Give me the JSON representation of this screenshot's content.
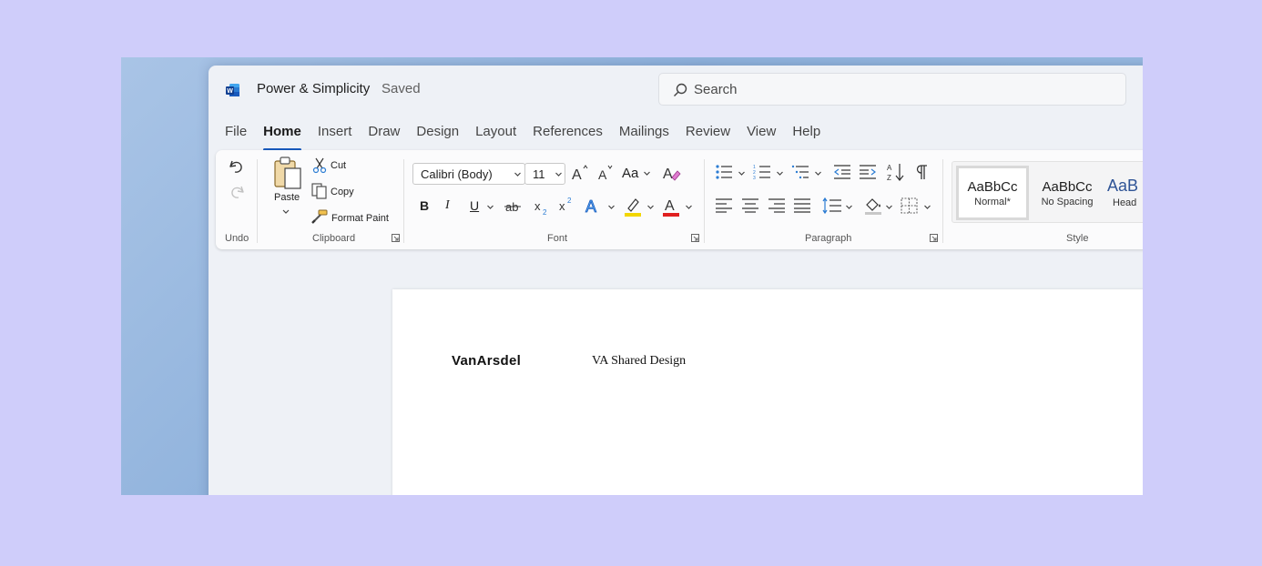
{
  "window": {
    "title": "Power & Simplicity",
    "status": "Saved"
  },
  "search": {
    "placeholder": "Search"
  },
  "tabs": [
    "File",
    "Home",
    "Insert",
    "Draw",
    "Design",
    "Layout",
    "References",
    "Mailings",
    "Review",
    "View",
    "Help"
  ],
  "active_tab": "Home",
  "ribbon": {
    "groups": {
      "undo": "Undo",
      "clipboard": "Clipboard",
      "font": "Font",
      "paragraph": "Paragraph",
      "style": "Style"
    },
    "clipboard": {
      "paste": "Paste",
      "cut": "Cut",
      "copy": "Copy",
      "format_paint": "Format Paint"
    },
    "font": {
      "family": "Calibri (Body)",
      "size": "11",
      "bold": "B",
      "italic": "I",
      "underline": "U",
      "change_case": "Aa"
    },
    "styles": [
      {
        "sample": "AaBbCc",
        "name": "Normal*"
      },
      {
        "sample": "AaBbCc",
        "name": "No Spacing"
      },
      {
        "sample": "AaB",
        "name": "Head"
      }
    ]
  },
  "document": {
    "logo": "VanArsdel",
    "heading": "VA Shared Design"
  },
  "colors": {
    "accent": "#185abd",
    "highlight": "#f2d600",
    "font_color": "#e02020",
    "background": "#cfcdfa"
  }
}
